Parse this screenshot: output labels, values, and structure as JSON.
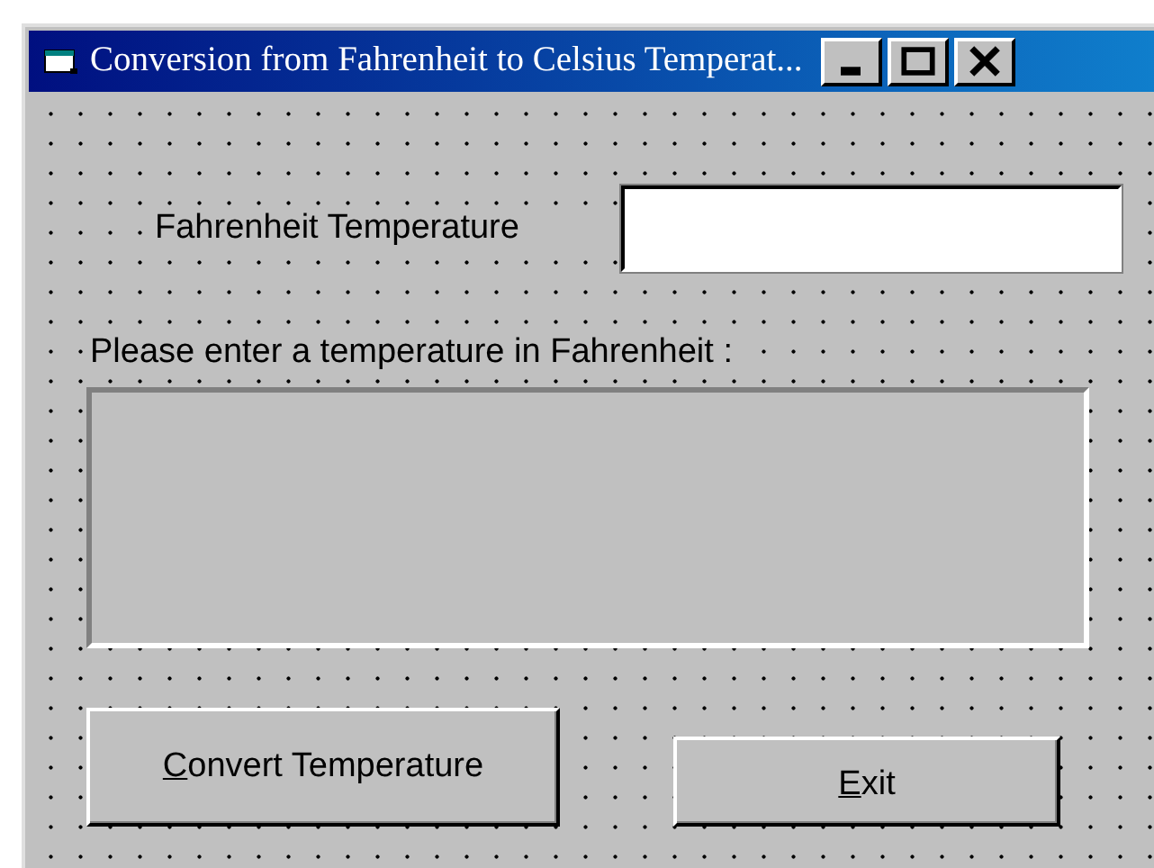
{
  "window": {
    "title": "Conversion from Fahrenheit to Celsius Temperat..."
  },
  "input_row": {
    "label": "Fahrenheit Temperature"
  },
  "prompt": "Please enter a temperature in Fahrenheit :",
  "buttons": [
    {
      "kind": "convert",
      "parts": [
        {
          "text": "C",
          "underlined": true
        },
        {
          "text": "onvert Temperature",
          "underlined": false
        }
      ]
    },
    {
      "kind": "exit",
      "parts": [
        {
          "text": "E",
          "underlined": true
        },
        {
          "text": "xit",
          "underlined": false
        }
      ]
    }
  ]
}
